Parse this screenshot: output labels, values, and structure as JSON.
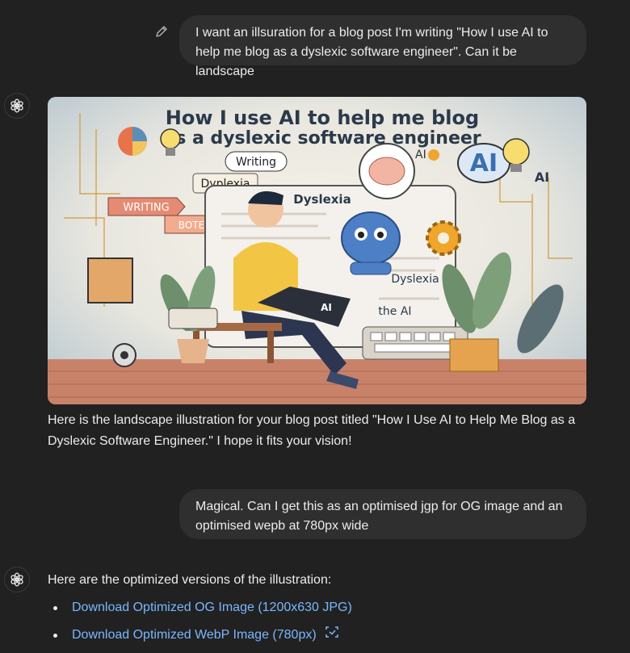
{
  "conversation": {
    "message1": {
      "role": "user",
      "text": "I want an illsuration for a blog post I'm writing \"How I use AI to help me blog as a dyslexic software engineer\". Can it be landscape"
    },
    "message2": {
      "role": "assistant",
      "image": {
        "title_line1": "How I use AI to help me blog",
        "title_line2": "as a dyslexic software engineer",
        "labels": {
          "writing_bubble": "Writing",
          "dyslexia_tag": "Dyplexia",
          "sign_writing": "WRITING",
          "sign_bote": "BOTE",
          "screen_dyslexia": "Dyslexia",
          "robot_dyslexia": "Dyslexia",
          "laptop_ai": "AI",
          "the_ai": "the AI",
          "cloud_ai": "AI",
          "side_ai": "AI",
          "small_ai": "AI"
        }
      },
      "text": "Here is the landscape illustration for your blog post titled \"How I Use AI to Help Me Blog as a Dyslexic Software Engineer.\" I hope it fits your vision!"
    },
    "message3": {
      "role": "user",
      "text": "Magical. Can I get this as an optimised jgp for OG image and an optimised wepb at 780px wide"
    },
    "message4": {
      "role": "assistant",
      "text": "Here are the optimized versions of the illustration:",
      "links": [
        {
          "label": "Download Optimized OG Image (1200x630 JPG)"
        },
        {
          "label": "Download Optimized WebP Image (780px)"
        }
      ]
    }
  },
  "icons": {
    "edit": "pencil-icon",
    "assistant_avatar": "openai-logo-icon",
    "external": "external-link-icon"
  },
  "colors": {
    "background": "#212121",
    "user_bubble": "#2f2f2f",
    "text": "#ececec",
    "link": "#7ab7ff"
  }
}
